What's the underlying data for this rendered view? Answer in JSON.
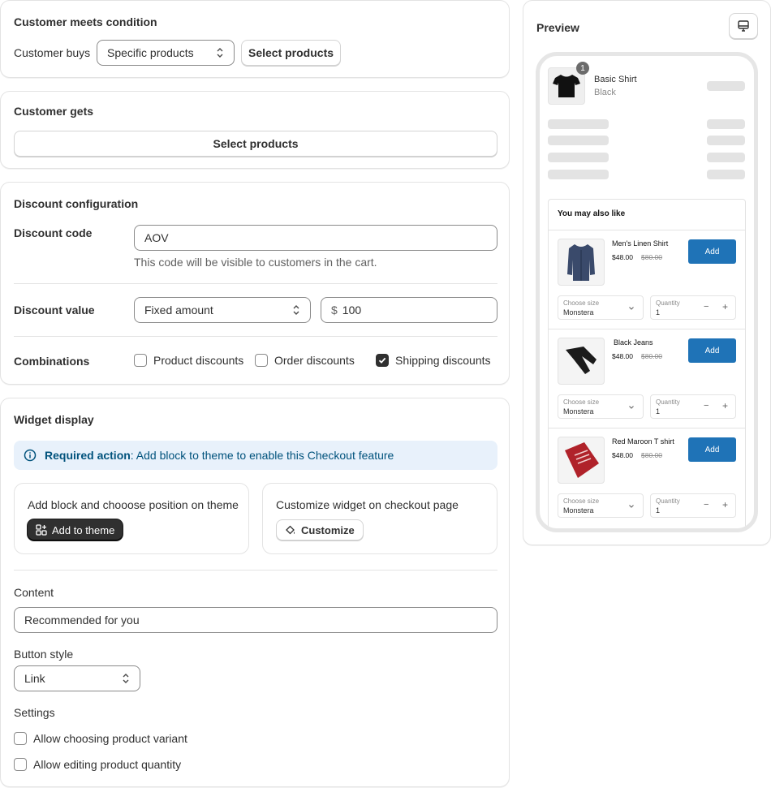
{
  "condition": {
    "title": "Customer meets condition",
    "buys_label": "Customer buys",
    "buys_value": "Specific products",
    "select_products": "Select products"
  },
  "gets": {
    "title": "Customer gets",
    "select_products": "Select products"
  },
  "discount": {
    "title": "Discount configuration",
    "code_label": "Discount code",
    "code_value": "AOV",
    "code_helper": "This code will be visible to customers in the cart.",
    "value_label": "Discount value",
    "value_type": "Fixed amount",
    "currency": "$",
    "amount": "100",
    "combinations_label": "Combinations",
    "combinations": [
      {
        "label": "Product discounts",
        "checked": false
      },
      {
        "label": "Order discounts",
        "checked": false
      },
      {
        "label": "Shipping discounts",
        "checked": true
      }
    ]
  },
  "widget": {
    "title": "Widget display",
    "banner_bold": "Required action",
    "banner_text": ": Add block to theme to enable this Checkout feature",
    "block_title": "Add block and chooose position on theme",
    "add_to_theme": "Add to theme",
    "customize_title": "Customize widget on checkout page",
    "customize": "Customize",
    "content_label": "Content",
    "content_value": "Recommended for you",
    "button_style_label": "Button style",
    "button_style_value": "Link",
    "settings_label": "Settings",
    "settings": [
      {
        "label": "Allow choosing product variant",
        "checked": false
      },
      {
        "label": "Allow editing product quantity",
        "checked": false
      }
    ]
  },
  "preview": {
    "title": "Preview",
    "cart_item": {
      "name": "Basic Shirt",
      "variant": "Black",
      "qty_badge": "1"
    },
    "upsell_title": "You may also like",
    "products": [
      {
        "name": "Men's Linen Shirt",
        "price": "$48.00",
        "compare": "$80.00",
        "add": "Add",
        "size_caption": "Choose size",
        "size_value": "Monstera",
        "qty_caption": "Quantity",
        "qty_value": "1",
        "color": "#3a4a6b"
      },
      {
        "name": "Black Jeans",
        "price": "$48.00",
        "compare": "$80.00",
        "add": "Add",
        "size_caption": "Choose size",
        "size_value": "Monstera",
        "qty_caption": "Quantity",
        "qty_value": "1",
        "color": "#1b1b1b"
      },
      {
        "name": "Red Maroon T shirt",
        "price": "$48.00",
        "compare": "$80.00",
        "add": "Add",
        "size_caption": "Choose size",
        "size_value": "Monstera",
        "qty_caption": "Quantity",
        "qty_value": "1",
        "color": "#b0222a"
      }
    ],
    "minus": "−",
    "plus": "+"
  }
}
